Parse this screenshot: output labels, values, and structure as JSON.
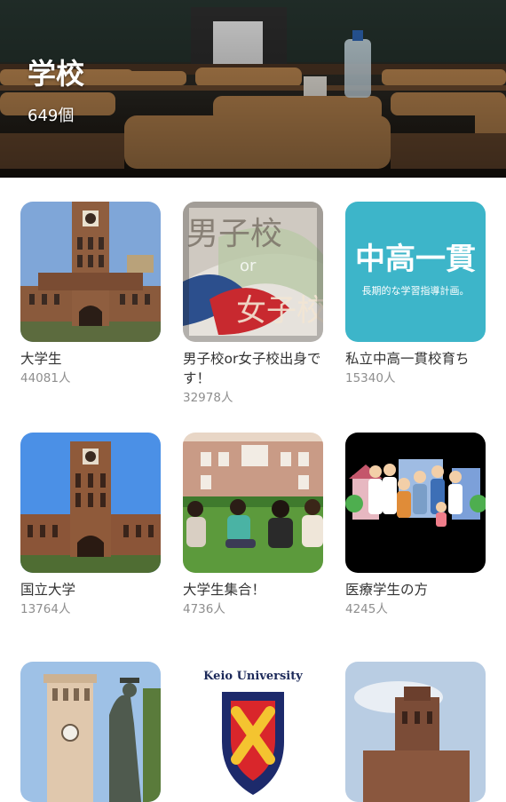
{
  "header": {
    "title": "学校",
    "count": "649個"
  },
  "cards": [
    {
      "name": "大学生",
      "count": "44081人",
      "image": "university-tower-photo"
    },
    {
      "name": "男子校or女子校出身です！",
      "count": "32978人",
      "image": "boys-girls-school-image",
      "overlay_top": "男子校",
      "overlay_mid": "or",
      "overlay_bottom": "女子校"
    },
    {
      "name": "私立中高一貫校育ち",
      "count": "15340人",
      "image": "integrated-school-banner",
      "banner_title": "中高一貫",
      "banner_sub": "長期的な学習指導計画。"
    },
    {
      "name": "国立大学",
      "count": "13764人",
      "image": "university-tower-photo"
    },
    {
      "name": "大学生集合！",
      "count": "4736人",
      "image": "students-on-lawn-photo"
    },
    {
      "name": "医療学生の方",
      "count": "4245人",
      "image": "medical-illustration"
    },
    {
      "name": "",
      "count": "",
      "image": "clock-tower-statue-photo"
    },
    {
      "name": "",
      "count": "",
      "image": "keio-logo",
      "logo_text": "Keio University"
    },
    {
      "name": "",
      "count": "",
      "image": "brick-tower-photo"
    }
  ]
}
